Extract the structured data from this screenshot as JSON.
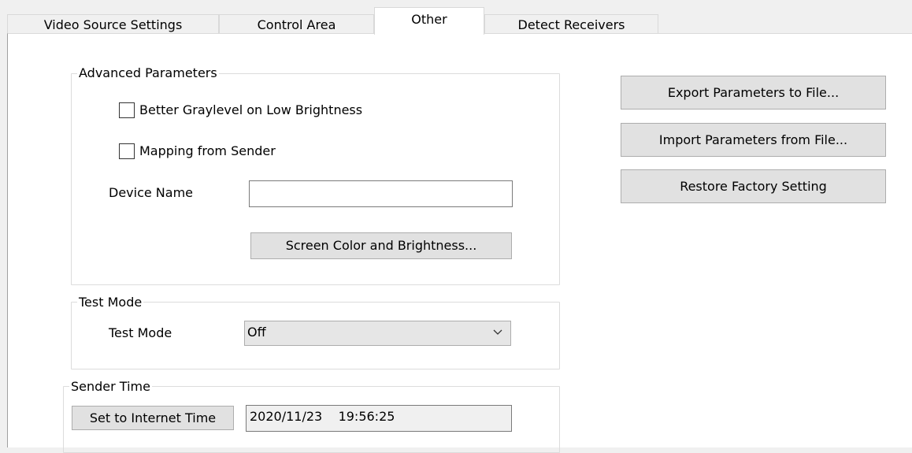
{
  "tabs": [
    {
      "label": "Video Source Settings"
    },
    {
      "label": "Control Area"
    },
    {
      "label": "Other"
    },
    {
      "label": "Detect Receivers"
    }
  ],
  "active_tab": "Other",
  "advanced": {
    "legend": "Advanced Parameters",
    "better_graylevel": {
      "label": "Better Graylevel on Low Brightness",
      "checked": false
    },
    "mapping_sender": {
      "label": "Mapping from Sender",
      "checked": false
    },
    "device_name_label": "Device Name",
    "device_name_value": "",
    "screen_color_button": "Screen Color and Brightness..."
  },
  "test_mode": {
    "legend": "Test Mode",
    "label": "Test Mode",
    "selected": "Off"
  },
  "sender_time": {
    "legend": "Sender Time",
    "set_button": "Set to Internet Time",
    "value": "2020/11/23    19:56:25"
  },
  "actions": {
    "export_button": "Export Parameters to File...",
    "import_button": "Import Parameters from File...",
    "restore_button": "Restore Factory Setting"
  }
}
